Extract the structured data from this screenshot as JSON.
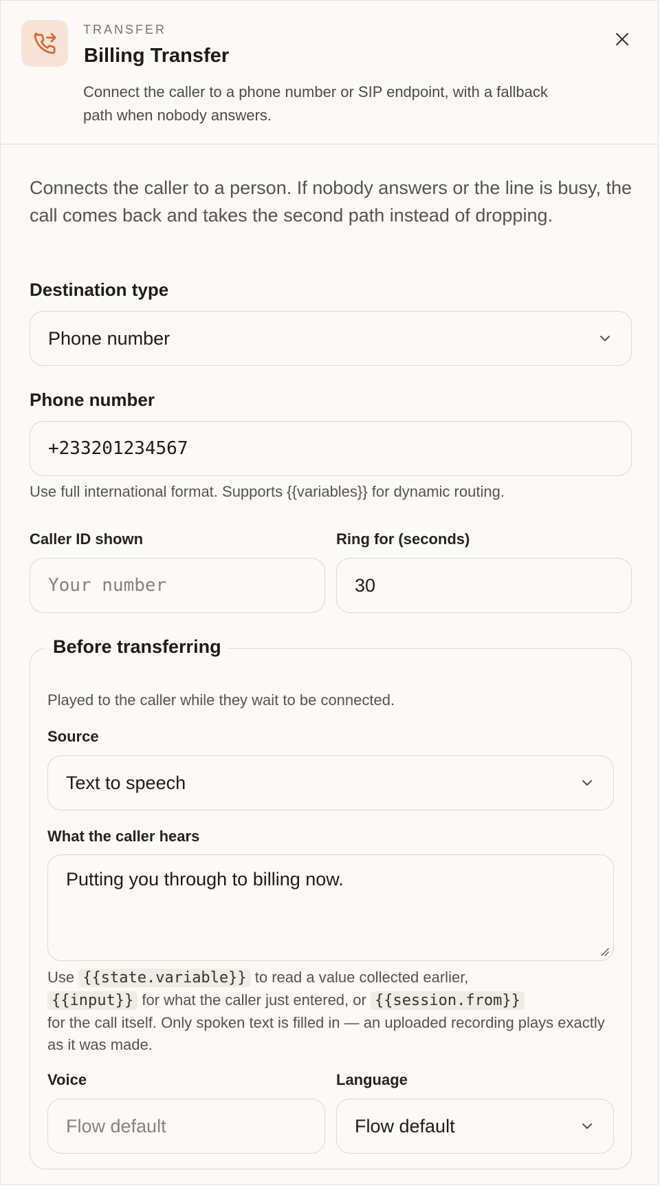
{
  "header": {
    "eyebrow": "TRANSFER",
    "title": "Billing Transfer",
    "subtitle": "Connect the caller to a phone number or SIP endpoint, with a fallback path when nobody answers.",
    "icon": "phone-forward-icon",
    "accent": "#d9662e"
  },
  "intro": "Connects the caller to a person. If nobody answers or the line is busy, the call comes back and takes the second path instead of dropping.",
  "destination": {
    "label": "Destination type",
    "value": "Phone number"
  },
  "phone": {
    "label": "Phone number",
    "value": "+233201234567",
    "help": "Use full international format. Supports {{variables}} for dynamic routing."
  },
  "caller_id": {
    "label": "Caller ID shown",
    "placeholder": "Your number"
  },
  "ring": {
    "label": "Ring for (seconds)",
    "value": "30"
  },
  "before": {
    "legend": "Before transferring",
    "description": "Played to the caller while they wait to be connected.",
    "source_label": "Source",
    "source_value": "Text to speech",
    "hears_label": "What the caller hears",
    "hears_value": "Putting you through to billing now.",
    "help": {
      "t1": "Use ",
      "c1": "{{state.variable}}",
      "t2": " to read a value collected earlier,",
      "c2": "{{input}}",
      "t3": " for what the caller just entered, or ",
      "c3": "{{session.from}}",
      "t4": "for the call itself. Only spoken text is filled in — an uploaded recording plays exactly as it was made."
    },
    "voice_label": "Voice",
    "voice_placeholder": "Flow default",
    "language_label": "Language",
    "language_value": "Flow default"
  }
}
